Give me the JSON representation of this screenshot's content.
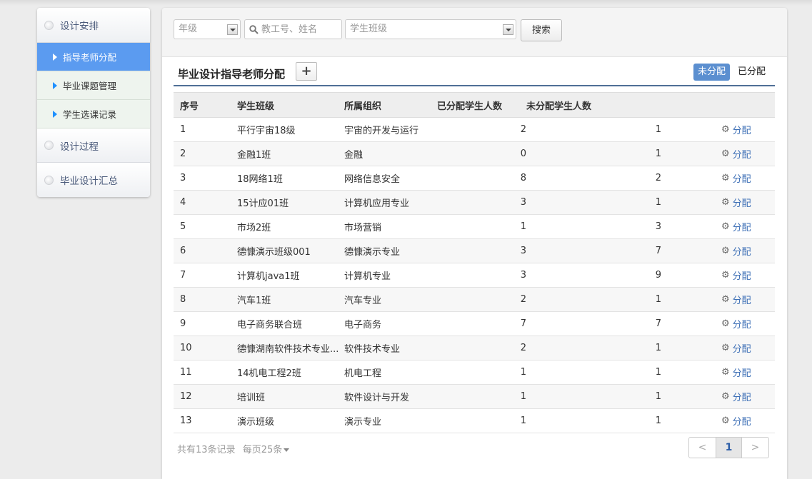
{
  "sidebar": {
    "groups": [
      {
        "label": "设计安排"
      },
      {
        "label": "设计过程"
      },
      {
        "label": "毕业设计汇总"
      }
    ],
    "items": [
      {
        "label": "指导老师分配"
      },
      {
        "label": "毕业课题管理"
      },
      {
        "label": "学生选课记录"
      }
    ]
  },
  "filters": {
    "grade_placeholder": "年级",
    "search_placeholder": "教工号、姓名",
    "class_placeholder": "学生班级",
    "search_button": "搜索"
  },
  "panel": {
    "title": "毕业设计指导老师分配",
    "add_label": "+",
    "tab_unassigned": "未分配",
    "tab_assigned": "已分配"
  },
  "table": {
    "headers": [
      "序号",
      "学生班级",
      "所属组织",
      "已分配学生人数",
      "未分配学生人数"
    ],
    "action_label": "分配",
    "rows": [
      [
        "1",
        "平行宇宙18级",
        "宇宙的开发与运行",
        "2",
        "1"
      ],
      [
        "2",
        "金融1班",
        "金融",
        "0",
        "1"
      ],
      [
        "3",
        "18网络1班",
        "网络信息安全",
        "8",
        "2"
      ],
      [
        "4",
        "15计应01班",
        "计算机应用专业",
        "3",
        "1"
      ],
      [
        "5",
        "市场2班",
        "市场营销",
        "1",
        "3"
      ],
      [
        "6",
        "德慷演示班级001",
        "德慷演示专业",
        "3",
        "7"
      ],
      [
        "7",
        "计算机java1班",
        "计算机专业",
        "3",
        "9"
      ],
      [
        "8",
        "汽车1班",
        "汽车专业",
        "2",
        "1"
      ],
      [
        "9",
        "电子商务联合班",
        "电子商务",
        "7",
        "7"
      ],
      [
        "10",
        "德慷湖南软件技术专业...",
        "软件技术专业",
        "2",
        "1"
      ],
      [
        "11",
        "14机电工程2班",
        "机电工程",
        "1",
        "1"
      ],
      [
        "12",
        "培训班",
        "软件设计与开发",
        "1",
        "1"
      ],
      [
        "13",
        "演示班级",
        "演示专业",
        "1",
        "1"
      ]
    ]
  },
  "footer": {
    "total": "共有13条记录",
    "per_page": "每页25条",
    "prev": "<",
    "page": "1",
    "next": ">"
  }
}
